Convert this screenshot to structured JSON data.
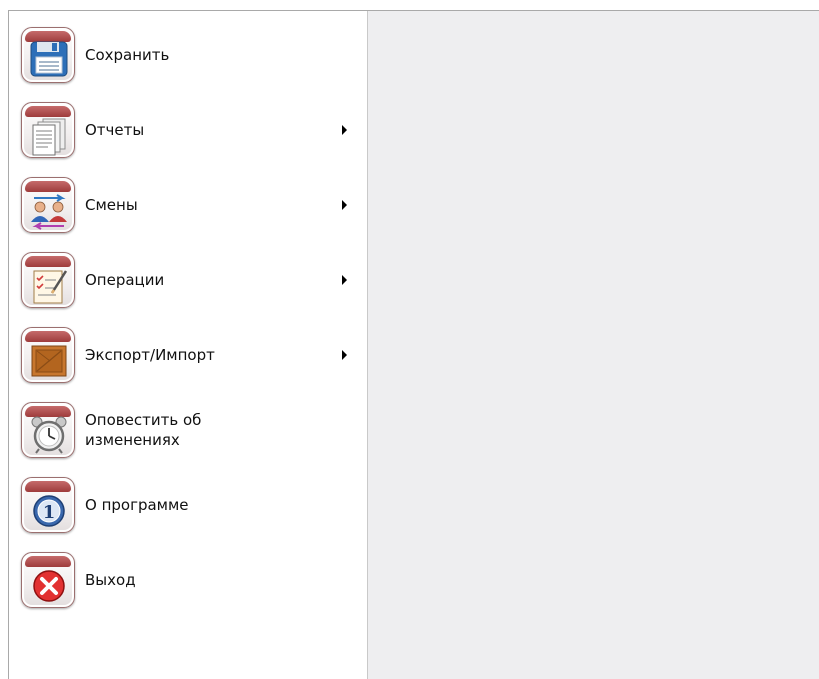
{
  "menu": {
    "items": [
      {
        "label": "Сохранить",
        "icon": "save-icon",
        "submenu": false
      },
      {
        "label": "Отчеты",
        "icon": "reports-icon",
        "submenu": true
      },
      {
        "label": "Смены",
        "icon": "shifts-icon",
        "submenu": true
      },
      {
        "label": "Операции",
        "icon": "operations-icon",
        "submenu": true
      },
      {
        "label": "Экспорт/Импорт",
        "icon": "export-import-icon",
        "submenu": true
      },
      {
        "label": "Оповестить об\nизменениях",
        "line1": "Оповестить об",
        "line2": "изменениях",
        "icon": "alarm-clock-icon",
        "submenu": false
      },
      {
        "label": "О программе",
        "icon": "info-icon",
        "submenu": false
      },
      {
        "label": "Выход",
        "icon": "exit-icon",
        "submenu": false
      }
    ]
  },
  "colors": {
    "tile_header": "#b04a4a",
    "panel_bg": "#eeeef0",
    "hover": "#f6e9b3"
  }
}
